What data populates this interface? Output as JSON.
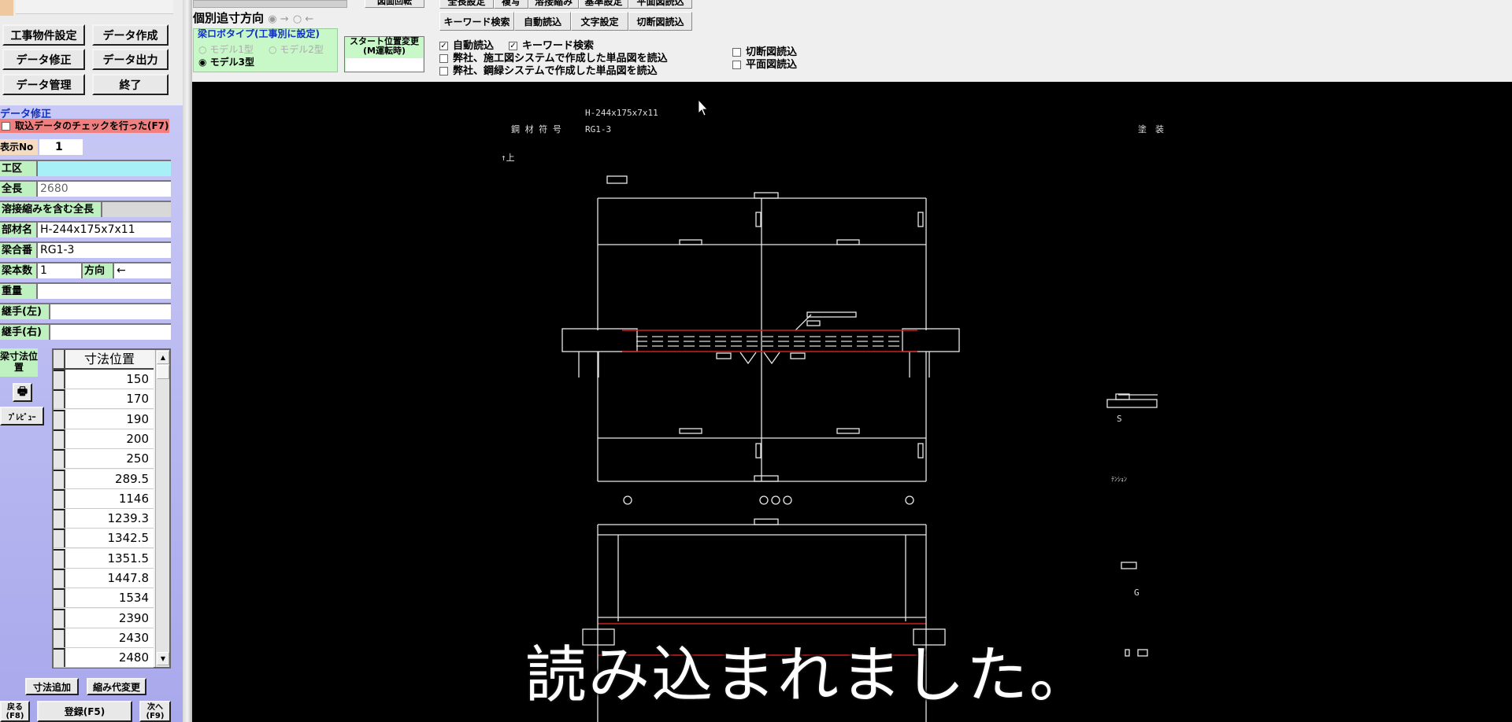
{
  "left_buttons": {
    "project_settings": "工事物件設定",
    "create_data": "データ作成",
    "edit_data": "データ修正",
    "export_data": "データ出力",
    "manage_data": "データ管理",
    "exit": "終了"
  },
  "edit_panel": {
    "title": "データ修正",
    "check_label": "取込データのチェックを行った(F7)",
    "display_no_label": "表示No",
    "display_no": "1",
    "fields": [
      {
        "label": "工区",
        "value": ""
      },
      {
        "label": "全長",
        "value": "2680"
      },
      {
        "label": "溶接縮みを含む全長",
        "value": ""
      },
      {
        "label": "部材名",
        "value": "H-244x175x7x11"
      },
      {
        "label": "梁合番",
        "value": "RG1-3"
      },
      {
        "label": "重量",
        "value": ""
      },
      {
        "label": "継手(左)",
        "value": ""
      },
      {
        "label": "継手(右)",
        "value": ""
      }
    ],
    "count_label": "梁本数",
    "count": "1",
    "direction_label": "方向",
    "direction": "←",
    "dim_pos_label": "梁寸法位置",
    "preview": "ﾌﾟﾚﾋﾞｭｰ",
    "table_header": "寸法位置",
    "table_values": [
      "150",
      "170",
      "190",
      "200",
      "250",
      "289.5",
      "1146",
      "1239.3",
      "1342.5",
      "1351.5",
      "1447.8",
      "1534",
      "2390",
      "2430",
      "2480"
    ],
    "add_dim": "寸法追加",
    "change_shrink": "縮み代変更",
    "back": "戻る(F8)",
    "register": "登録(F5)",
    "next": "次へ(F9)"
  },
  "top": {
    "rotate": "図面回転",
    "dim_direction_label": "個別追寸方向",
    "dir_right": "→",
    "dir_left": "←",
    "robot_group": "梁ロボタイプ(工事別に設定)",
    "model1": "モデル1型",
    "model2": "モデル2型",
    "model3": "モデル3型",
    "start_pos": "スタート位置変更",
    "start_pos_sub": "(M運転時)",
    "start_value": "",
    "toolbar_row1": [
      "全長設定",
      "複写",
      "溶接縮み",
      "基準設定",
      "平面図読込"
    ],
    "toolbar_row2": [
      "キーワード検索",
      "自動読込",
      "文字設定",
      "切断図読込"
    ],
    "checks": [
      {
        "label": "自動読込",
        "checked": true
      },
      {
        "label": "キーワード検索",
        "checked": true
      },
      {
        "label": "弊社、施工図システムで作成した単品図を読込",
        "checked": false
      },
      {
        "label": "弊社、鋼緑システムで作成した単品図を読込",
        "checked": false
      },
      {
        "label": "切断図読込",
        "checked": false
      },
      {
        "label": "平面図読込",
        "checked": false
      }
    ]
  },
  "drawing": {
    "section": "H-244x175x7x11",
    "mark_label": "鋼 材 符 号",
    "mark": "RG1-3",
    "paint": "塗　装",
    "up": "↑上",
    "s_label": "S",
    "g_label": "G",
    "note": "ﾃﾝｼｮﾝ"
  },
  "caption": "読み込まれました。",
  "colors": {
    "canvas": "#000000",
    "line": "#ffffff",
    "red": "#cc2020",
    "panel": "#b8b8f0",
    "label_green": "#bff0c0"
  }
}
